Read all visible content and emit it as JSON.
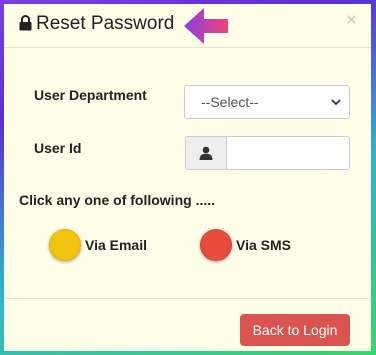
{
  "header": {
    "title": "Reset Password",
    "close_glyph": "×",
    "lock_icon": "lock-icon",
    "arrow_icon": "arrow-left-icon",
    "arrow_color": "#e8477e"
  },
  "form": {
    "department_label": "User Department",
    "department_select_value": "--Select--",
    "user_id_label": "User Id",
    "user_id_value": "",
    "user_icon": "user-icon"
  },
  "options": {
    "instructions": "Click any one of following .....",
    "email": {
      "label": "Via Email",
      "color": "#f2c40f"
    },
    "sms": {
      "label": "Via SMS",
      "color": "#e74c3c"
    }
  },
  "footer": {
    "back_label": "Back to Login",
    "back_color": "#d9534f"
  },
  "colors": {
    "modal_background": "#fdfde8"
  }
}
